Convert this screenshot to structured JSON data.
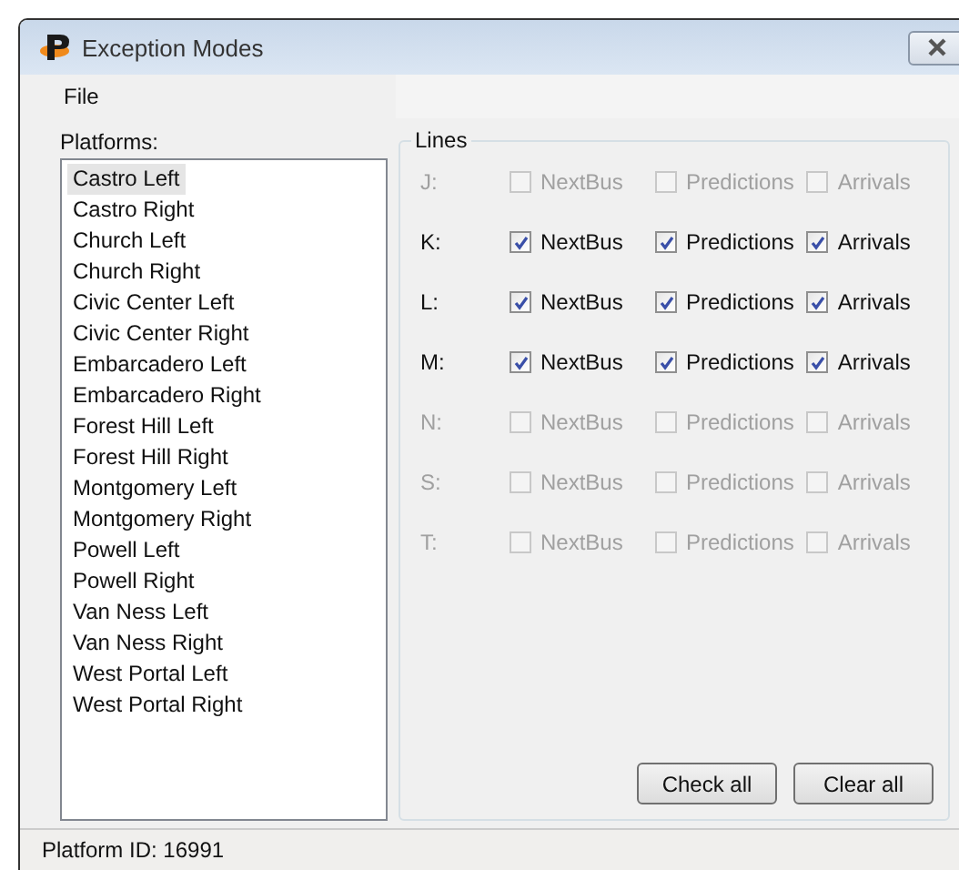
{
  "window": {
    "title": "Exception Modes"
  },
  "menu": [
    "File"
  ],
  "platforms": {
    "label": "Platforms:",
    "items": [
      {
        "label": "Castro Left",
        "selected": true
      },
      {
        "label": "Castro Right",
        "selected": false
      },
      {
        "label": "Church Left",
        "selected": false
      },
      {
        "label": "Church Right",
        "selected": false
      },
      {
        "label": "Civic Center Left",
        "selected": false
      },
      {
        "label": "Civic Center Right",
        "selected": false
      },
      {
        "label": "Embarcadero Left",
        "selected": false
      },
      {
        "label": "Embarcadero Right",
        "selected": false
      },
      {
        "label": "Forest Hill Left",
        "selected": false
      },
      {
        "label": "Forest Hill Right",
        "selected": false
      },
      {
        "label": "Montgomery Left",
        "selected": false
      },
      {
        "label": "Montgomery Right",
        "selected": false
      },
      {
        "label": "Powell Left",
        "selected": false
      },
      {
        "label": "Powell Right",
        "selected": false
      },
      {
        "label": "Van Ness Left",
        "selected": false
      },
      {
        "label": "Van Ness Right",
        "selected": false
      },
      {
        "label": "West Portal Left",
        "selected": false
      },
      {
        "label": "West Portal Right",
        "selected": false
      }
    ]
  },
  "lines": {
    "title": "Lines",
    "rows": [
      {
        "label": "J:",
        "disabled": true,
        "options": [
          {
            "label": "NextBus",
            "checked": false
          },
          {
            "label": "Predictions",
            "checked": false
          },
          {
            "label": "Arrivals",
            "checked": false
          }
        ]
      },
      {
        "label": "K:",
        "disabled": false,
        "options": [
          {
            "label": "NextBus",
            "checked": true
          },
          {
            "label": "Predictions",
            "checked": true
          },
          {
            "label": "Arrivals",
            "checked": true
          }
        ]
      },
      {
        "label": "L:",
        "disabled": false,
        "options": [
          {
            "label": "NextBus",
            "checked": true
          },
          {
            "label": "Predictions",
            "checked": true
          },
          {
            "label": "Arrivals",
            "checked": true
          }
        ]
      },
      {
        "label": "M:",
        "disabled": false,
        "options": [
          {
            "label": "NextBus",
            "checked": true
          },
          {
            "label": "Predictions",
            "checked": true
          },
          {
            "label": "Arrivals",
            "checked": true
          }
        ]
      },
      {
        "label": "N:",
        "disabled": true,
        "options": [
          {
            "label": "NextBus",
            "checked": false
          },
          {
            "label": "Predictions",
            "checked": false
          },
          {
            "label": "Arrivals",
            "checked": false
          }
        ]
      },
      {
        "label": "S:",
        "disabled": true,
        "options": [
          {
            "label": "NextBus",
            "checked": false
          },
          {
            "label": "Predictions",
            "checked": false
          },
          {
            "label": "Arrivals",
            "checked": false
          }
        ]
      },
      {
        "label": "T:",
        "disabled": true,
        "options": [
          {
            "label": "NextBus",
            "checked": false
          },
          {
            "label": "Predictions",
            "checked": false
          },
          {
            "label": "Arrivals",
            "checked": false
          }
        ]
      }
    ],
    "buttons": [
      "Check all",
      "Clear all"
    ]
  },
  "status_bar": "Platform ID: 16991"
}
